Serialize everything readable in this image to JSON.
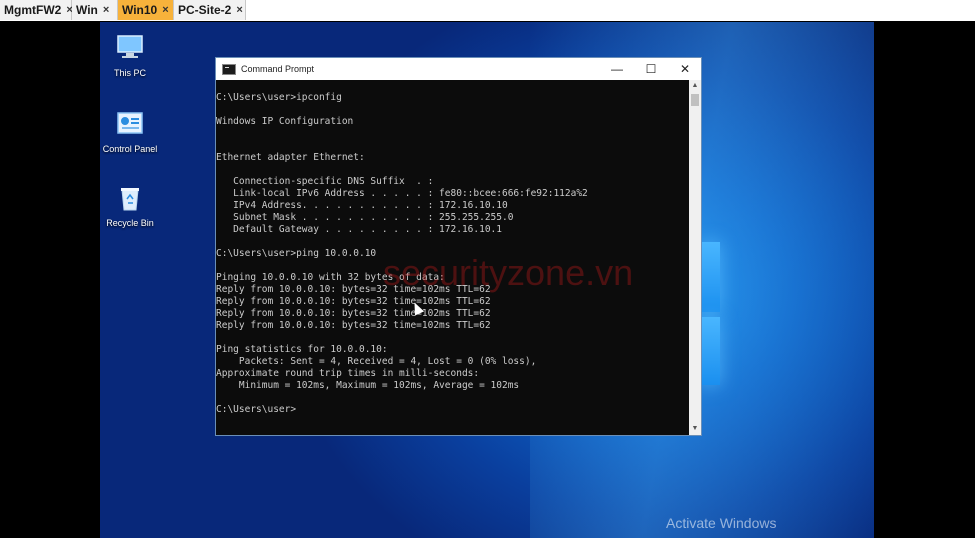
{
  "tabs": [
    {
      "label": "MgmtFW2",
      "close": "×"
    },
    {
      "label": "Win",
      "close": "×"
    },
    {
      "label": "Win10",
      "close": "×"
    },
    {
      "label": "PC-Site-2",
      "close": "×"
    }
  ],
  "desktop": {
    "icons": [
      {
        "label": "This PC",
        "icon": "this-pc-icon"
      },
      {
        "label": "Control Panel",
        "icon": "control-panel-icon"
      },
      {
        "label": "Recycle Bin",
        "icon": "recycle-bin-icon"
      }
    ],
    "activate_text": "Activate Windows",
    "watermark": "securityzone.vn"
  },
  "cmd": {
    "title": "Command Prompt",
    "minimize": "—",
    "maximize": "☐",
    "close": "✕",
    "lines": [
      "C:\\Users\\user>ipconfig",
      "",
      "Windows IP Configuration",
      "",
      "",
      "Ethernet adapter Ethernet:",
      "",
      "   Connection-specific DNS Suffix  . :",
      "   Link-local IPv6 Address . . . . . : fe80::bcee:666:fe92:112a%2",
      "   IPv4 Address. . . . . . . . . . . : 172.16.10.10",
      "   Subnet Mask . . . . . . . . . . . : 255.255.255.0",
      "   Default Gateway . . . . . . . . . : 172.16.10.1",
      "",
      "C:\\Users\\user>ping 10.0.0.10",
      "",
      "Pinging 10.0.0.10 with 32 bytes of data:",
      "Reply from 10.0.0.10: bytes=32 time=102ms TTL=62",
      "Reply from 10.0.0.10: bytes=32 time=102ms TTL=62",
      "Reply from 10.0.0.10: bytes=32 time=102ms TTL=62",
      "Reply from 10.0.0.10: bytes=32 time=102ms TTL=62",
      "",
      "Ping statistics for 10.0.0.10:",
      "    Packets: Sent = 4, Received = 4, Lost = 0 (0% loss),",
      "Approximate round trip times in milli-seconds:",
      "    Minimum = 102ms, Maximum = 102ms, Average = 102ms",
      "",
      "C:\\Users\\user>"
    ]
  }
}
